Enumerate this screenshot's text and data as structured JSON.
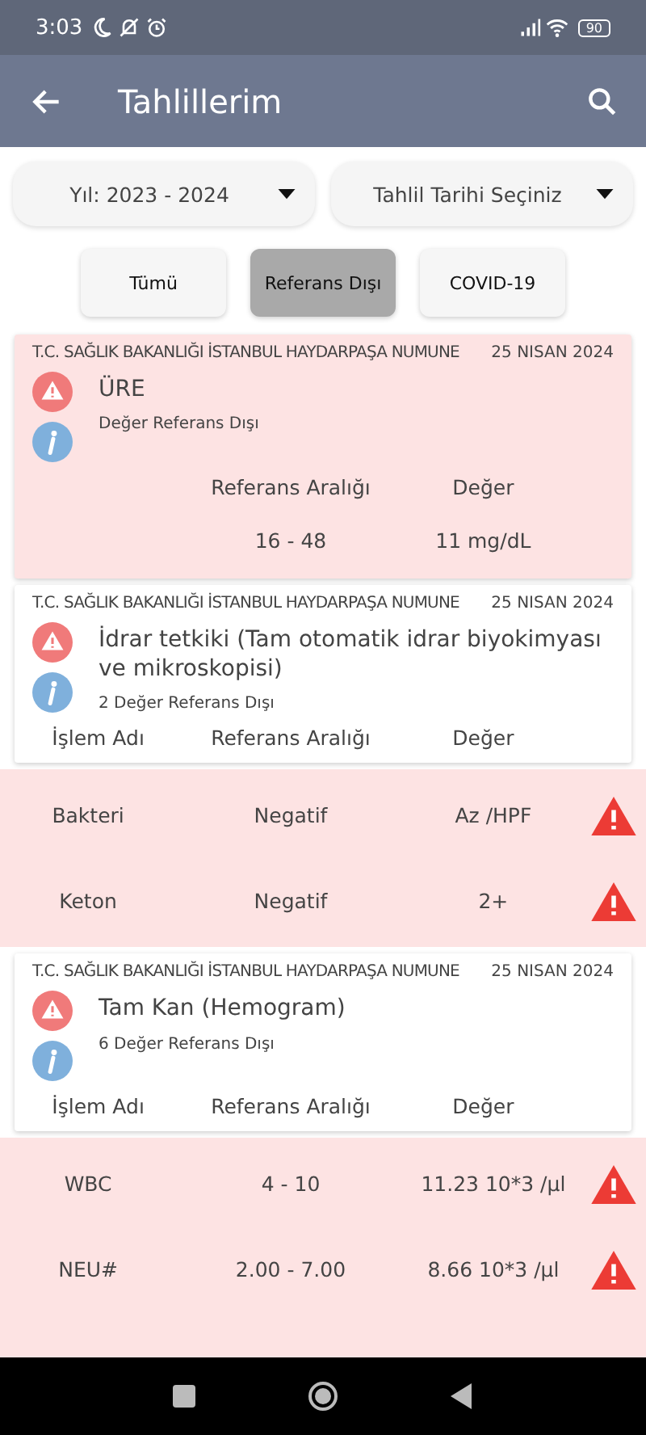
{
  "status_bar": {
    "time": "3:03",
    "battery": "90"
  },
  "app_bar": {
    "title": "Tahlillerim"
  },
  "filters": [
    {
      "label": "Yıl: 2023 - 2024"
    },
    {
      "label": "Tahlil Tarihi Seçiniz"
    }
  ],
  "chips": [
    {
      "label": "Tümü",
      "selected": false
    },
    {
      "label": "Referans Dışı",
      "selected": true
    },
    {
      "label": "COVID-19",
      "selected": false
    }
  ],
  "results": [
    {
      "hospital": "T.C. SAĞLIK BAKANLIĞI İSTANBUL HAYDARPAŞA NUMUNE",
      "date": "25 NISAN 2024",
      "title": "ÜRE",
      "summary": "Değer Referans Dışı",
      "highlighted": true,
      "columns": [
        "Referans Aralığı",
        "Değer"
      ],
      "values": [
        "16 - 48",
        "11 mg/dL"
      ]
    },
    {
      "hospital": "T.C. SAĞLIK BAKANLIĞI İSTANBUL HAYDARPAŞA NUMUNE",
      "date": "25 NISAN 2024",
      "title": "İdrar tetkiki (Tam otomatik idrar biyokimyası ve mikroskopisi)",
      "summary": "2 Değer Referans Dışı",
      "highlighted": false,
      "columns": [
        "İşlem Adı",
        "Referans Aralığı",
        "Değer"
      ],
      "rows": [
        {
          "name": "Bakteri",
          "range": "Negatif",
          "value": "Az /HPF"
        },
        {
          "name": "Keton",
          "range": "Negatif",
          "value": "2+"
        }
      ]
    },
    {
      "hospital": "T.C. SAĞLIK BAKANLIĞI İSTANBUL HAYDARPAŞA NUMUNE",
      "date": "25 NISAN 2024",
      "title": "Tam Kan (Hemogram)",
      "summary": "6 Değer Referans Dışı",
      "highlighted": false,
      "columns": [
        "İşlem Adı",
        "Referans Aralığı",
        "Değer"
      ],
      "rows": [
        {
          "name": "WBC",
          "range": "4 - 10",
          "value": "11.23 10*3 /µl"
        },
        {
          "name": "NEU#",
          "range": "2.00 - 7.00",
          "value": "8.66 10*3 /µl"
        }
      ]
    }
  ]
}
